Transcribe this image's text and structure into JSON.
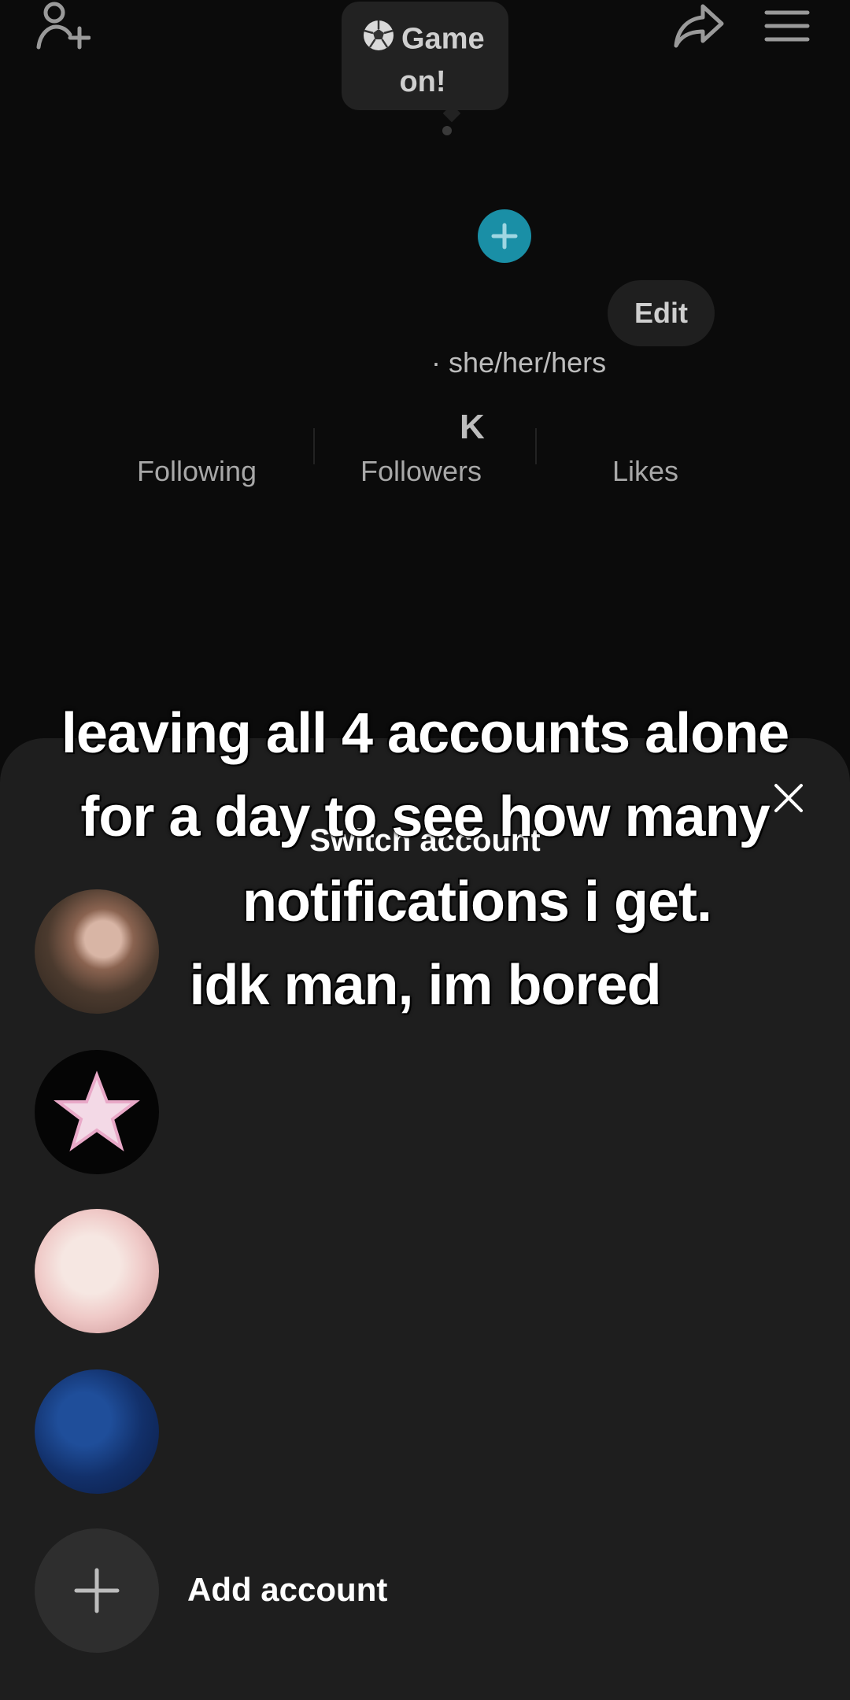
{
  "status_bubble": {
    "line1": "Game",
    "line2": "on!"
  },
  "profile": {
    "edit_label": "Edit",
    "pronouns": "· she/her/hers",
    "followers_value": "K",
    "stats": {
      "following": "Following",
      "followers": "Followers",
      "likes": "Likes"
    }
  },
  "sheet": {
    "title": "Switch account",
    "add_account_label": "Add account"
  },
  "caption": {
    "line1": "leaving all 4 accounts alone",
    "line2": "for a day to see how many",
    "line3": "notifications i get.",
    "line4": "idk man, im bored"
  },
  "colors": {
    "accent_add": "#1a8fa6",
    "sheet_bg": "#1e1e1e"
  }
}
